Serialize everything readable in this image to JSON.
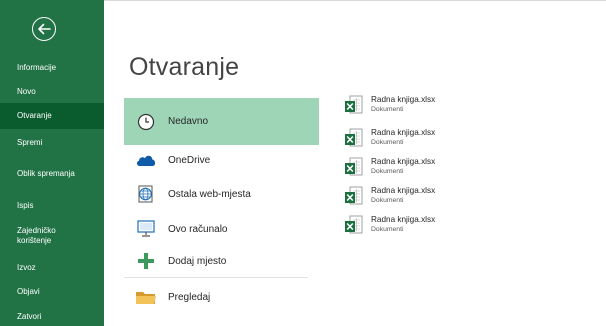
{
  "colors": {
    "sidebar": "#217346",
    "sidebar_active": "#0a5c2f",
    "location_active": "#9fd5b7"
  },
  "sidebar": {
    "back_icon": "arrow-left-circle-icon",
    "items": [
      {
        "label": "Informacije"
      },
      {
        "label": "Novo"
      },
      {
        "label": "Otvaranje",
        "active": true
      },
      {
        "label": "Spremi"
      },
      {
        "label": "Oblik spremanja"
      },
      {
        "label": "Ispis"
      },
      {
        "label": "Zajedničko korištenje"
      },
      {
        "label": "Izvoz"
      },
      {
        "label": "Objavi"
      },
      {
        "label": "Zatvori"
      }
    ]
  },
  "main": {
    "title": "Otvaranje",
    "locations": [
      {
        "label": "Nedavno",
        "icon": "clock-icon",
        "active": true
      },
      {
        "label": "OneDrive",
        "icon": "cloud-icon"
      },
      {
        "label": "Ostala web-mjesta",
        "icon": "globe-icon"
      },
      {
        "label": "Ovo računalo",
        "icon": "computer-icon"
      },
      {
        "label": "Dodaj mjesto",
        "icon": "plus-icon"
      },
      {
        "label": "Pregledaj",
        "icon": "folder-icon"
      }
    ],
    "recent_files": [
      {
        "name": "Radna knjiga.xlsx",
        "location": "Dokumenti",
        "icon": "excel-file-icon"
      },
      {
        "name": "Radna knjiga.xlsx",
        "location": "Dokumenti",
        "icon": "excel-file-icon"
      },
      {
        "name": "Radna knjiga.xlsx",
        "location": "Dokumenti",
        "icon": "excel-file-icon"
      },
      {
        "name": "Radna knjiga.xlsx",
        "location": "Dokumenti",
        "icon": "excel-file-icon"
      },
      {
        "name": "Radna knjiga.xlsx",
        "location": "Dokumenti",
        "icon": "excel-file-icon"
      }
    ]
  }
}
